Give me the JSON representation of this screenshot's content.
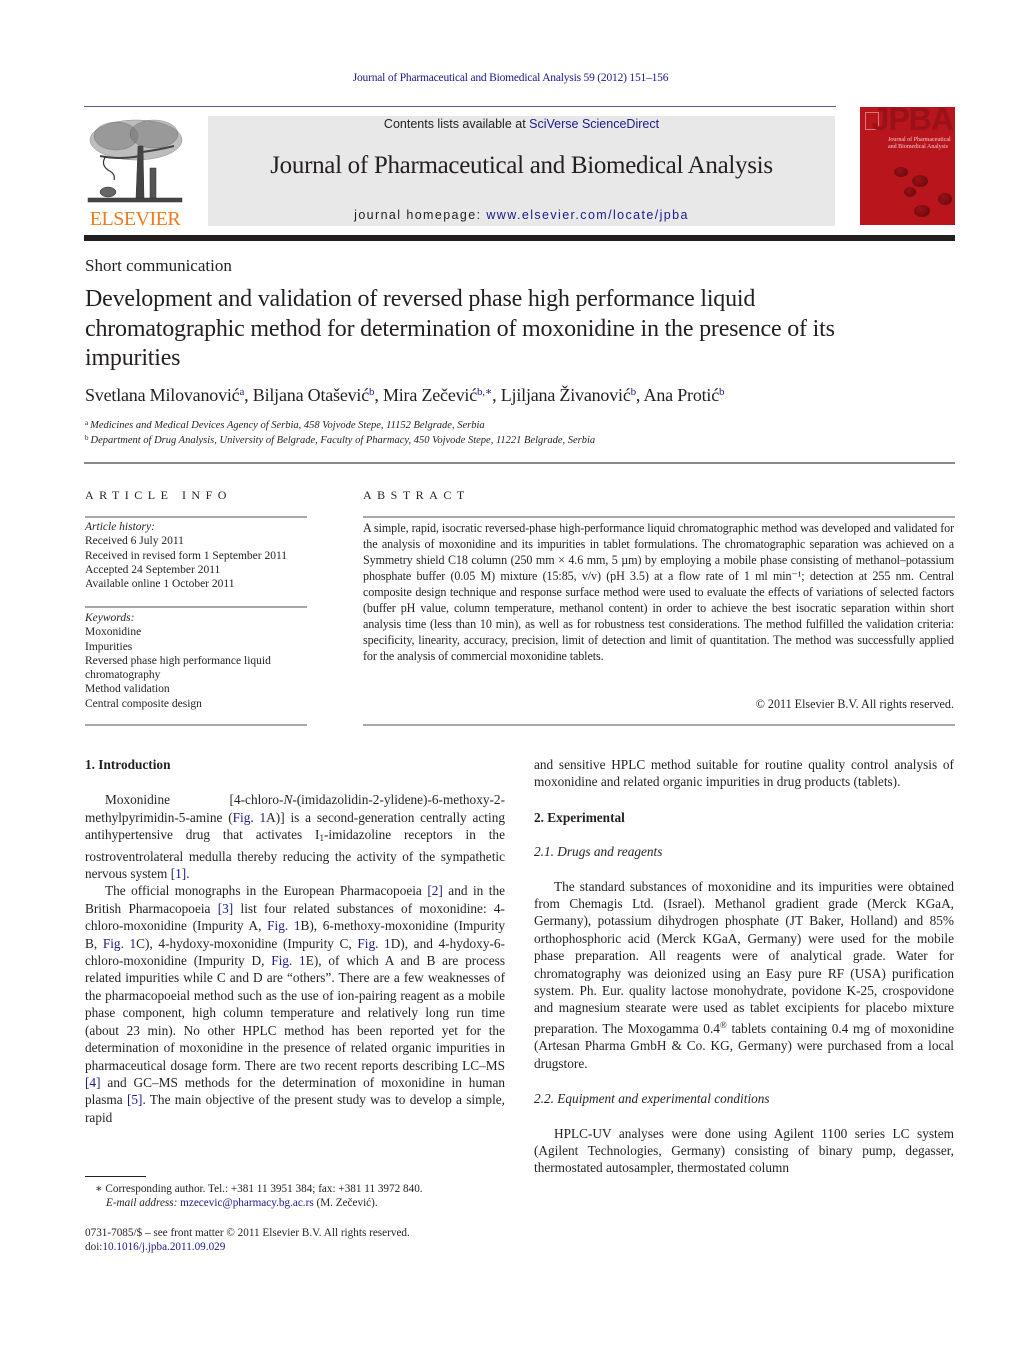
{
  "header": {
    "journal_citation": "Journal of Pharmaceutical and Biomedical Analysis 59 (2012) 151–156",
    "contents_prefix": "Contents lists available at ",
    "contents_link": "SciVerse ScienceDirect",
    "journal_name": "Journal of Pharmaceutical and Biomedical Analysis",
    "homepage_prefix": "journal homepage: ",
    "homepage_link": "www.elsevier.com/locate/jpba",
    "publisher_logo_text": "ELSEVIER",
    "cover_title": "JPBA",
    "cover_subtitle": "Journal of Pharmaceutical and Biomedical Analysis",
    "colors": {
      "publisher_orange": "#f07b1e",
      "link_blue": "#1a1a8c",
      "cover_red": "#b8151c",
      "banner_gray": "#e8e8e8"
    }
  },
  "article": {
    "section_type": "Short communication",
    "title": "Development and validation of reversed phase high performance liquid chromatographic method for determination of moxonidine in the presence of its impurities",
    "authors": [
      {
        "name": "Svetlana Milovanović",
        "sup": "a",
        "sep": ", "
      },
      {
        "name": "Biljana Otašević",
        "sup": "b",
        "sep": ", "
      },
      {
        "name": "Mira Zečević",
        "sup": "b,∗",
        "sep": ", "
      },
      {
        "name": "Ljiljana Živanović",
        "sup": "b",
        "sep": ", "
      },
      {
        "name": "Ana Protić",
        "sup": "b",
        "sep": ""
      }
    ],
    "affiliations": [
      {
        "mark": "a",
        "text": "Medicines and Medical Devices Agency of Serbia, 458 Vojvode Stepe, 11152 Belgrade, Serbia"
      },
      {
        "mark": "b",
        "text": "Department of Drug Analysis, University of Belgrade, Faculty of Pharmacy, 450 Vojvode Stepe, 11221 Belgrade, Serbia"
      }
    ]
  },
  "article_info": {
    "heading": "ARTICLE INFO",
    "history_label": "Article history:",
    "history": [
      "Received 6 July 2011",
      "Received in revised form 1 September 2011",
      "Accepted 24 September 2011",
      "Available online 1 October 2011"
    ],
    "keywords_label": "Keywords:",
    "keywords": [
      "Moxonidine",
      "Impurities",
      "Reversed phase high performance liquid chromatography",
      "Method validation",
      "Central composite design"
    ]
  },
  "abstract": {
    "heading": "ABSTRACT",
    "text": "A simple, rapid, isocratic reversed-phase high-performance liquid chromatographic method was developed and validated for the analysis of moxonidine and its impurities in tablet formulations. The chromatographic separation was achieved on a Symmetry shield C18 column (250 mm × 4.6 mm, 5 µm) by employing a mobile phase consisting of methanol–potassium phosphate buffer (0.05 M) mixture (15:85, v/v) (pH 3.5) at a flow rate of 1 ml min⁻¹; detection at 255 nm. Central composite design technique and response surface method were used to evaluate the effects of variations of selected factors (buffer pH value, column temperature, methanol content) in order to achieve the best isocratic separation within short analysis time (less than 10 min), as well as for robustness test considerations. The method fulfilled the validation criteria: specificity, linearity, accuracy, precision, limit of detection and limit of quantitation. The method was successfully applied for the analysis of commercial moxonidine tablets.",
    "copyright": "© 2011 Elsevier B.V. All rights reserved."
  },
  "body": {
    "intro_heading": "1.  Introduction",
    "intro_p1": {
      "t1": "Moxonidine [4-chloro-",
      "t1_italic": "N",
      "t2": "-(imidazolidin-2-ylidene)-6-methoxy-2-methylpyrimidin-5-amine (",
      "fig1a": "Fig. 1",
      "t3": "A)] is a second-generation centrally acting antihypertensive drug that activates I",
      "sub1": "1",
      "t4": "-imidazoline receptors in the rostroventrolateral medulla thereby reducing the activity of the sympathetic nervous system ",
      "ref1": "[1]",
      "t5": "."
    },
    "intro_p2": {
      "t1": "The official monographs in the European Pharmacopoeia ",
      "ref2": "[2]",
      "t2": " and in the British Pharmacopoeia ",
      "ref3": "[3]",
      "t3": " list four related substances of moxonidine: 4-chloro-moxonidine (Impurity A, ",
      "fig1b": "Fig. 1",
      "t4": "B), 6-methoxy-moxonidine (Impurity B, ",
      "fig1c": "Fig. 1",
      "t5": "C), 4-hydoxy-moxonidine (Impurity C, ",
      "fig1d": "Fig. 1",
      "t6": "D), and 4-hydoxy-6-chloro-moxonidine (Impurity D, ",
      "fig1e": "Fig. 1",
      "t7": "E), of which A and B are process related impurities while C and D are “others”. There are a few weaknesses of the pharmacopoeial method such as the use of ion-pairing reagent as a mobile phase component, high column temperature and relatively long run time (about 23 min). No other HPLC method has been reported yet for the determination of moxonidine in the presence of related organic impurities in pharmaceutical dosage form. There are two recent reports describing LC–MS ",
      "ref4": "[4]",
      "t8": " and GC–MS methods for the determination of moxonidine in human plasma ",
      "ref5": "[5]",
      "t9": ". The main objective of the present study was to develop a simple, rapid"
    },
    "right_p0": "and sensitive HPLC method suitable for routine quality control analysis of moxonidine and related organic impurities in drug products (tablets).",
    "exp_heading": "2.  Experimental",
    "sub21_heading": "2.1.  Drugs and reagents",
    "sub21_p": {
      "t1": "The standard substances of moxonidine and its impurities were obtained from Chemagis Ltd. (Israel). Methanol gradient grade (Merck KGaA, Germany), potassium dihydrogen phosphate (JT Baker, Holland) and 85% orthophosphoric acid (Merck KGaA, Germany) were used for the mobile phase preparation. All reagents were of analytical grade. Water for chromatography was deionized using an Easy pure RF (USA) purification system. Ph. Eur. quality lactose monohydrate, povidone K-25, crospovidone and magnesium stearate were used as tablet excipients for placebo mixture preparation. The Moxogamma 0.4",
      "sup": "®",
      "t2": " tablets containing 0.4 mg of moxonidine (Artesan Pharma GmbH & Co. KG, Germany) were purchased from a local drugstore."
    },
    "sub22_heading": "2.2.  Equipment and experimental conditions",
    "sub22_p": "HPLC-UV analyses were done using Agilent 1100 series LC system (Agilent Technologies, Germany) consisting of binary pump, degasser, thermostated autosampler, thermostated column"
  },
  "footnotes": {
    "corresponding": "∗ Corresponding author. Tel.: +381 11 3951 384; fax: +381 11 3972 840.",
    "email_label": "E-mail address: ",
    "email": "mzecevic@pharmacy.bg.ac.rs",
    "email_suffix": " (M. Zečević).",
    "front_matter": "0731-7085/$ – see front matter © 2011 Elsevier B.V. All rights reserved.",
    "doi_prefix": "doi:",
    "doi": "10.1016/j.jpba.2011.09.029"
  }
}
